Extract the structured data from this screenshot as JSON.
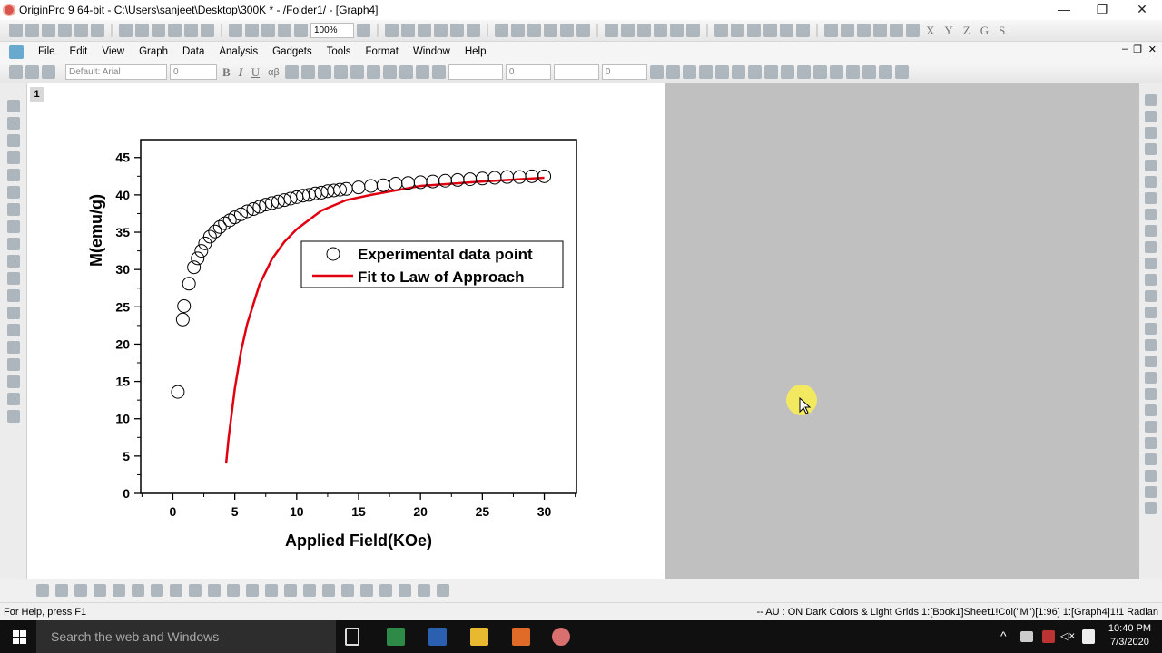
{
  "window": {
    "title": "OriginPro 9 64-bit - C:\\Users\\sanjeet\\Desktop\\300K * - /Folder1/ - [Graph4]",
    "minimize": "—",
    "restore": "❐",
    "close": "✕"
  },
  "toolbar1": {
    "zoom_value": "100%",
    "letters": [
      "X",
      "Y",
      "Z",
      "G",
      "S"
    ]
  },
  "menu": [
    "File",
    "Edit",
    "View",
    "Graph",
    "Data",
    "Analysis",
    "Gadgets",
    "Tools",
    "Format",
    "Window",
    "Help"
  ],
  "toolbar2": {
    "font": "Default: Arial",
    "font_size": "0",
    "bold": "B",
    "italic": "I",
    "underline": "U",
    "greek": "αβ",
    "line_width": "0",
    "border_width": "0",
    "child_close": "✕",
    "child_restore": "❐",
    "child_min": "–"
  },
  "layer_tab": "1",
  "chart_data": {
    "type": "scatter",
    "xlabel": "Applied Field(KOe)",
    "ylabel": "M(emu/g)",
    "xlim": [
      -2.6,
      32.6
    ],
    "ylim": [
      0,
      47.4
    ],
    "xticks": [
      0,
      5,
      10,
      15,
      20,
      25,
      30
    ],
    "yticks": [
      0,
      5,
      10,
      15,
      20,
      25,
      30,
      35,
      40,
      45
    ],
    "grid": false,
    "legend_position": "center-right",
    "series": [
      {
        "name": "Experimental data point",
        "style": "open-circle",
        "color": "#000000",
        "x": [
          0.4,
          0.8,
          0.9,
          1.3,
          1.7,
          2.0,
          2.3,
          2.6,
          3.0,
          3.4,
          3.8,
          4.2,
          4.6,
          5.0,
          5.5,
          6,
          6.5,
          7,
          7.5,
          8,
          8.5,
          9,
          9.5,
          10,
          10.5,
          11,
          11.5,
          12,
          12.5,
          13,
          13.5,
          14,
          15,
          16,
          17,
          18,
          19,
          20,
          21,
          22,
          23,
          24,
          25,
          26,
          27,
          28,
          29,
          30
        ],
        "y": [
          13.6,
          23.3,
          25.1,
          28.1,
          30.3,
          31.5,
          32.5,
          33.5,
          34.4,
          35.1,
          35.7,
          36.2,
          36.6,
          37.0,
          37.4,
          37.8,
          38.1,
          38.4,
          38.7,
          38.9,
          39.1,
          39.3,
          39.5,
          39.7,
          39.9,
          40.0,
          40.2,
          40.3,
          40.5,
          40.6,
          40.7,
          40.8,
          41.0,
          41.2,
          41.3,
          41.5,
          41.6,
          41.7,
          41.8,
          41.9,
          42.0,
          42.1,
          42.2,
          42.3,
          42.4,
          42.4,
          42.5,
          42.5
        ]
      },
      {
        "name": "Fit to Law of Approach",
        "style": "line",
        "color": "#e0000f",
        "x": [
          4.3,
          4.5,
          5,
          5.5,
          6,
          7,
          8,
          9,
          10,
          12,
          14,
          16,
          18,
          20,
          25,
          30
        ],
        "y": [
          4.0,
          7.4,
          14.0,
          19.0,
          22.7,
          28.0,
          31.4,
          33.7,
          35.4,
          37.9,
          39.3,
          40.0,
          40.6,
          41.2,
          41.8,
          42.3
        ]
      }
    ]
  },
  "status": {
    "help": "For Help, press F1",
    "info": "-- AU : ON  Dark Colors & Light Grids  1:[Book1]Sheet1!Col(\"M\")[1:96]  1:[Graph4]1!1  Radian"
  },
  "taskbar": {
    "search_placeholder": "Search the web and Windows",
    "time": "10:40 PM",
    "date": "7/3/2020"
  },
  "colors": {
    "fit_line": "#e0000f",
    "gray_area": "#c0c0c0",
    "taskbar": "#101010"
  }
}
